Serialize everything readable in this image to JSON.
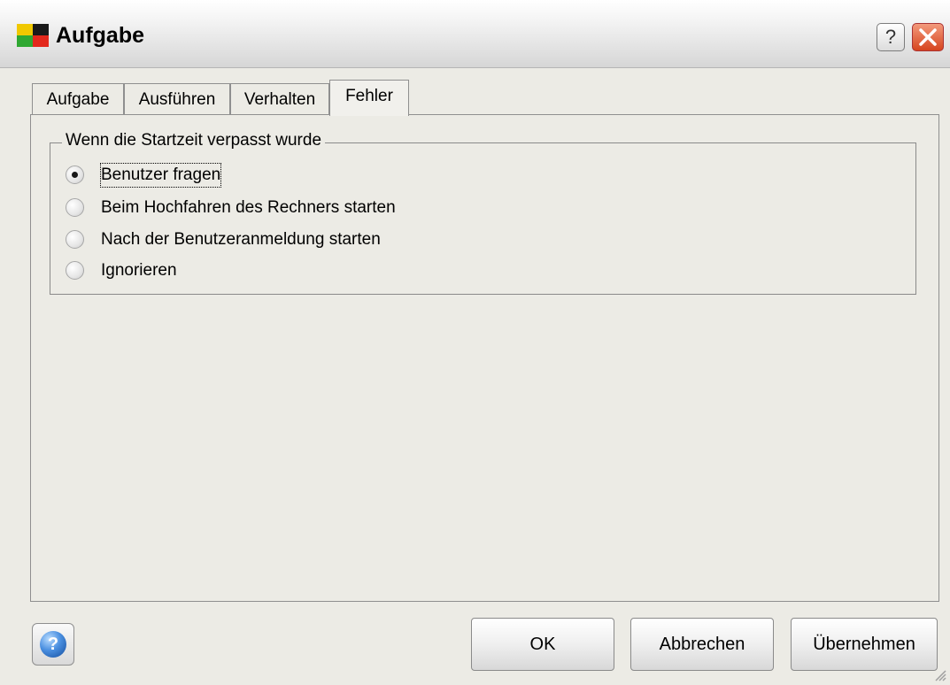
{
  "window": {
    "title": "Aufgabe",
    "help_glyph": "?",
    "close_icon": "close-icon"
  },
  "tabs": [
    {
      "label": "Aufgabe"
    },
    {
      "label": "Ausführen"
    },
    {
      "label": "Verhalten"
    },
    {
      "label": "Fehler",
      "active": true
    }
  ],
  "group": {
    "title": "Wenn die Startzeit verpasst wurde",
    "options": [
      {
        "label": "Benutzer fragen",
        "selected": true
      },
      {
        "label": "Beim Hochfahren des Rechners starten",
        "selected": false
      },
      {
        "label": "Nach der Benutzeranmeldung starten",
        "selected": false
      },
      {
        "label": "Ignorieren",
        "selected": false
      }
    ]
  },
  "buttons": {
    "help_glyph": "?",
    "ok": "OK",
    "cancel": "Abbrechen",
    "apply": "Übernehmen"
  },
  "colors": {
    "background": "#ecebe5",
    "close_button": "#d6451e",
    "help_ball": "#4a8fe0"
  }
}
